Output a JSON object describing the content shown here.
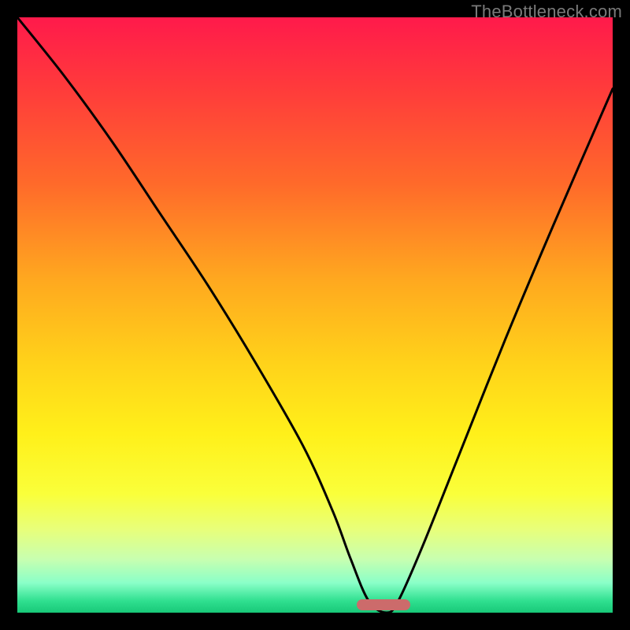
{
  "watermark": "TheBottleneck.com",
  "colors": {
    "page_bg": "#000000",
    "gradient_top": "#ff1a4b",
    "gradient_bottom": "#18c878",
    "curve": "#000000",
    "marker": "#cc6b6b",
    "watermark_text": "#7a7a7a"
  },
  "chart_data": {
    "type": "line",
    "title": "",
    "xlabel": "",
    "ylabel": "",
    "xlim": [
      0,
      100
    ],
    "ylim": [
      0,
      100
    ],
    "grid": false,
    "legend": false,
    "series": [
      {
        "name": "bottleneck-curve",
        "x": [
          0,
          8,
          16,
          24,
          32,
          40,
          48,
          53,
          56,
          59,
          62,
          64,
          68,
          74,
          82,
          90,
          100
        ],
        "values": [
          100,
          90,
          79,
          67,
          55,
          42,
          28,
          17,
          9,
          2,
          0,
          2,
          11,
          26,
          46,
          65,
          88
        ]
      }
    ],
    "annotations": [
      {
        "name": "optimal-range-marker",
        "x_start": 57,
        "x_end": 66,
        "y": 0
      }
    ]
  }
}
